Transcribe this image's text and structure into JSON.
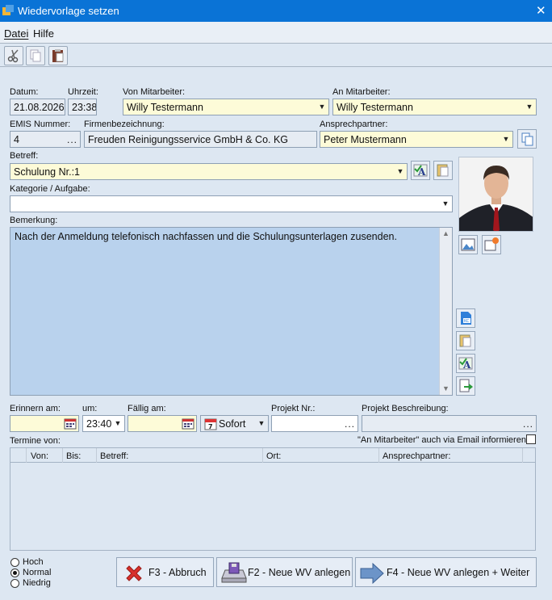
{
  "window": {
    "title": "Wiedervorlage setzen",
    "close_glyph": "✕"
  },
  "menu": [
    {
      "label": "Datei"
    },
    {
      "label": "Hilfe"
    }
  ],
  "toolbar": {
    "icons": [
      "cut-icon",
      "copy-icon",
      "paste-icon"
    ]
  },
  "labels": {
    "datum": "Datum:",
    "uhrzeit": "Uhrzeit:",
    "von_mitarbeiter": "Von Mitarbeiter:",
    "an_mitarbeiter": "An Mitarbeiter:",
    "emis_nummer": "EMIS Nummer:",
    "firmenbezeichnung": "Firmenbezeichnung:",
    "ansprechpartner": "Ansprechpartner:",
    "betreff": "Betreff:",
    "kategorie": "Kategorie / Aufgabe:",
    "bemerkung": "Bemerkung:",
    "erinnern_am": "Erinnern am:",
    "um": "um:",
    "faellig_am": "Fällig am:",
    "projekt_nr": "Projekt Nr.:",
    "projekt_beschreibung": "Projekt Beschreibung:",
    "termine_von": "Termine von:",
    "email_informieren": "\"An Mitarbeiter\" auch via Email informieren"
  },
  "fields": {
    "datum": "21.08.2026",
    "uhrzeit": "23:38",
    "von_mitarbeiter": "Willy Testermann",
    "an_mitarbeiter": "Willy Testermann",
    "emis_nummer": "4",
    "firmenbezeichnung": "Freuden Reinigungsservice GmbH & Co. KG",
    "ansprechpartner": "Peter Mustermann",
    "betreff": "Schulung Nr.:1",
    "kategorie": "",
    "bemerkung": "Nach der Anmeldung telefonisch nachfassen und die Schulungsunterlagen zusenden.",
    "erinnern_am": "",
    "erinnern_um": "23:40",
    "faellig_am": "",
    "sofort": "Sofort",
    "projekt_nr": "",
    "projekt_beschreibung": "",
    "ellipsis": "...",
    "email_checked": false
  },
  "table": {
    "columns": [
      "Von:",
      "Bis:",
      "Betreff:",
      "Ort:",
      "Ansprechpartner:"
    ],
    "rows": []
  },
  "priority": {
    "options": [
      "Hoch",
      "Normal",
      "Niedrig"
    ],
    "selected": "Normal"
  },
  "buttons": {
    "abbruch": "F3 - Abbruch",
    "neue_wv": "F2 - Neue WV anlegen",
    "neue_wv_weiter": "F4 - Neue WV anlegen + Weiter"
  },
  "colors": {
    "titlebar": "#0a73d6",
    "yellow_field": "#fdfbd8",
    "memo_field": "#b9d2ed",
    "background": "#dde7f2"
  }
}
